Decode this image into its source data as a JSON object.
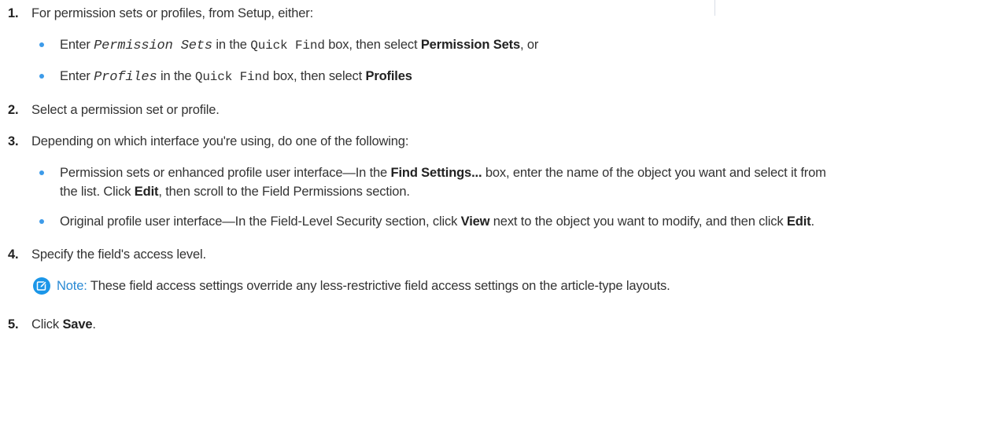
{
  "steps": [
    {
      "number": "1.",
      "text": "For permission sets or profiles, from Setup, either:",
      "bullets": [
        {
          "t1": "Enter ",
          "code": "Permission Sets",
          "t2": " in the ",
          "field": "Quick Find",
          "t3": " box, then select ",
          "ui": "Permission Sets",
          "t4": ", or"
        },
        {
          "t1": "Enter ",
          "code": "Profiles",
          "t2": " in the ",
          "field": "Quick Find",
          "t3": " box, then select ",
          "ui": "Profiles",
          "t4": ""
        }
      ]
    },
    {
      "number": "2.",
      "text": "Select a permission set or profile."
    },
    {
      "number": "3.",
      "text": "Depending on which interface you're using, do one of the following:",
      "bullets": [
        {
          "t1": "Permission sets or enhanced profile user interface—In the ",
          "ui1": "Find Settings...",
          "t2": " box, enter the name of the object you want and select it from the list. Click ",
          "ui2": "Edit",
          "t3": ", then scroll to the Field Permissions section."
        },
        {
          "t1": "Original profile user interface—In the Field-Level Security section, click ",
          "ui1": "View",
          "t2": " next to the object you want to modify, and then click ",
          "ui2": "Edit",
          "t3": "."
        }
      ]
    },
    {
      "number": "4.",
      "text": "Specify the field's access level.",
      "note": {
        "label": "Note:",
        "text": " These field access settings override any less-restrictive field access settings on the article-type layouts.",
        "icon": "edit-note-icon",
        "icon_color": "#1b96e8"
      }
    },
    {
      "number": "5.",
      "t1": "Click ",
      "ui": "Save",
      "t2": "."
    }
  ],
  "colors": {
    "bullet": "#3d9be9",
    "note_label": "#2a8ad4",
    "text": "#333333"
  }
}
